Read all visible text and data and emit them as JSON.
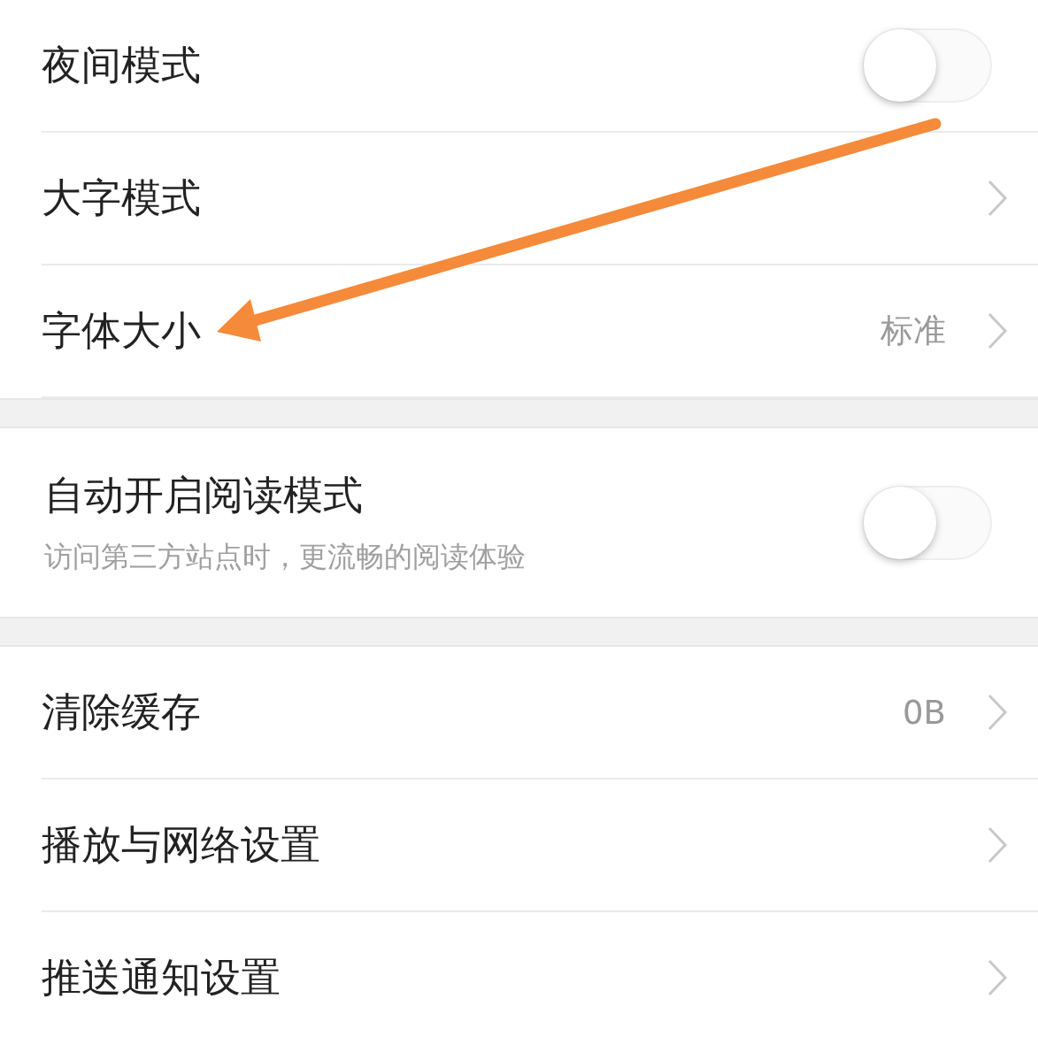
{
  "sections": [
    {
      "items": [
        {
          "kind": "toggle",
          "label": "夜间模式",
          "on": false
        },
        {
          "kind": "link",
          "label": "大字模式"
        },
        {
          "kind": "link",
          "label": "字体大小",
          "value": "标准"
        }
      ]
    },
    {
      "items": [
        {
          "kind": "toggle",
          "label": "自动开启阅读模式",
          "subtitle": "访问第三方站点时，更流畅的阅读体验",
          "on": false
        }
      ]
    },
    {
      "items": [
        {
          "kind": "link",
          "label": "清除缓存",
          "value": "0B"
        },
        {
          "kind": "link",
          "label": "播放与网络设置"
        },
        {
          "kind": "link",
          "label": "推送通知设置"
        }
      ]
    }
  ]
}
